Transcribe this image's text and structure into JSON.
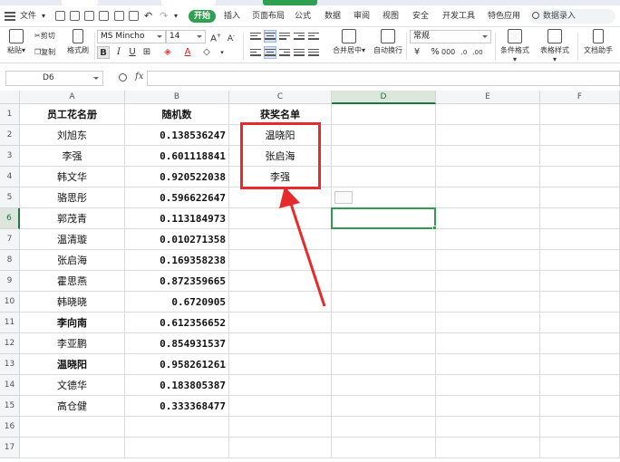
{
  "menu": {
    "file": "文件",
    "start": "开始",
    "insert": "插入",
    "layout": "页面布局",
    "formula": "公式",
    "data": "数据",
    "review": "审阅",
    "view": "视图",
    "security": "安全",
    "dev": "开发工具",
    "special": "特色应用",
    "search": "数据录入"
  },
  "ribbon": {
    "paste": "粘贴",
    "cut": "剪切",
    "copy": "复制",
    "format_painter": "格式刷",
    "font_name": "MS Mincho",
    "font_size": "14",
    "merge": "合并居中",
    "wrap": "自动换行",
    "number_format": "常规",
    "cond_format": "条件格式",
    "table_style": "表格样式",
    "doc_helper": "文档助手"
  },
  "formula_bar": {
    "name_box": "D6",
    "fx": "fx",
    "value": ""
  },
  "columns": [
    "A",
    "B",
    "C",
    "D",
    "E",
    "F"
  ],
  "rows": [
    "1",
    "2",
    "3",
    "4",
    "5",
    "6",
    "7",
    "8",
    "9",
    "10",
    "11",
    "12",
    "13",
    "14",
    "15",
    "16",
    "17"
  ],
  "table": {
    "header_a": "员工花名册",
    "header_b": "随机数",
    "header_c": "获奖名单",
    "names": [
      "刘旭东",
      "李强",
      "韩文华",
      "骆思彤",
      "郭茂青",
      "温清璇",
      "张启海",
      "霍思燕",
      "韩晓晓",
      "李向南",
      "李亚鹏",
      "温晓阳",
      "文德华",
      "高仓健"
    ],
    "numbers": [
      "0.138536247",
      "0.601118841",
      "0.920522038",
      "0.596622647",
      "0.113184973",
      "0.010271358",
      "0.169358238",
      "0.872359665",
      "0.6720905",
      "0.612356652",
      "0.854931537",
      "0.958261261",
      "0.183805387",
      "0.333368477"
    ],
    "winners": [
      "温晓阳",
      "张启海",
      "李强"
    ]
  },
  "colors": {
    "accent": "#2fa04f",
    "highlight": "#e52b2b"
  }
}
